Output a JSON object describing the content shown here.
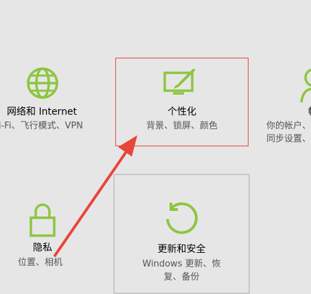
{
  "colors": {
    "background": "#e6e6e6",
    "icon_accent": "#8cc63f",
    "highlight_border": "#e8453c",
    "hover_border": "#c8c8c8",
    "annotation_arrow": "#e8453c"
  },
  "tiles": {
    "network": {
      "title": "网络和 Internet",
      "desc": "i-Fi、飞行模式、VPN",
      "icon": "globe-icon"
    },
    "personalization": {
      "title": "个性化",
      "desc": "背景、锁屏、颜色",
      "icon": "paint-monitor-icon"
    },
    "accounts": {
      "title": "帐",
      "desc_line1": "你的帐户、",
      "desc_line2": "同步设置、",
      "icon": "person-icon"
    },
    "privacy": {
      "title": "隐私",
      "desc": "位置、相机",
      "icon": "lock-icon"
    },
    "update": {
      "title": "更新和安全",
      "desc_line1": "Windows 更新、恢",
      "desc_line2": "复、备份",
      "icon": "refresh-icon"
    }
  }
}
